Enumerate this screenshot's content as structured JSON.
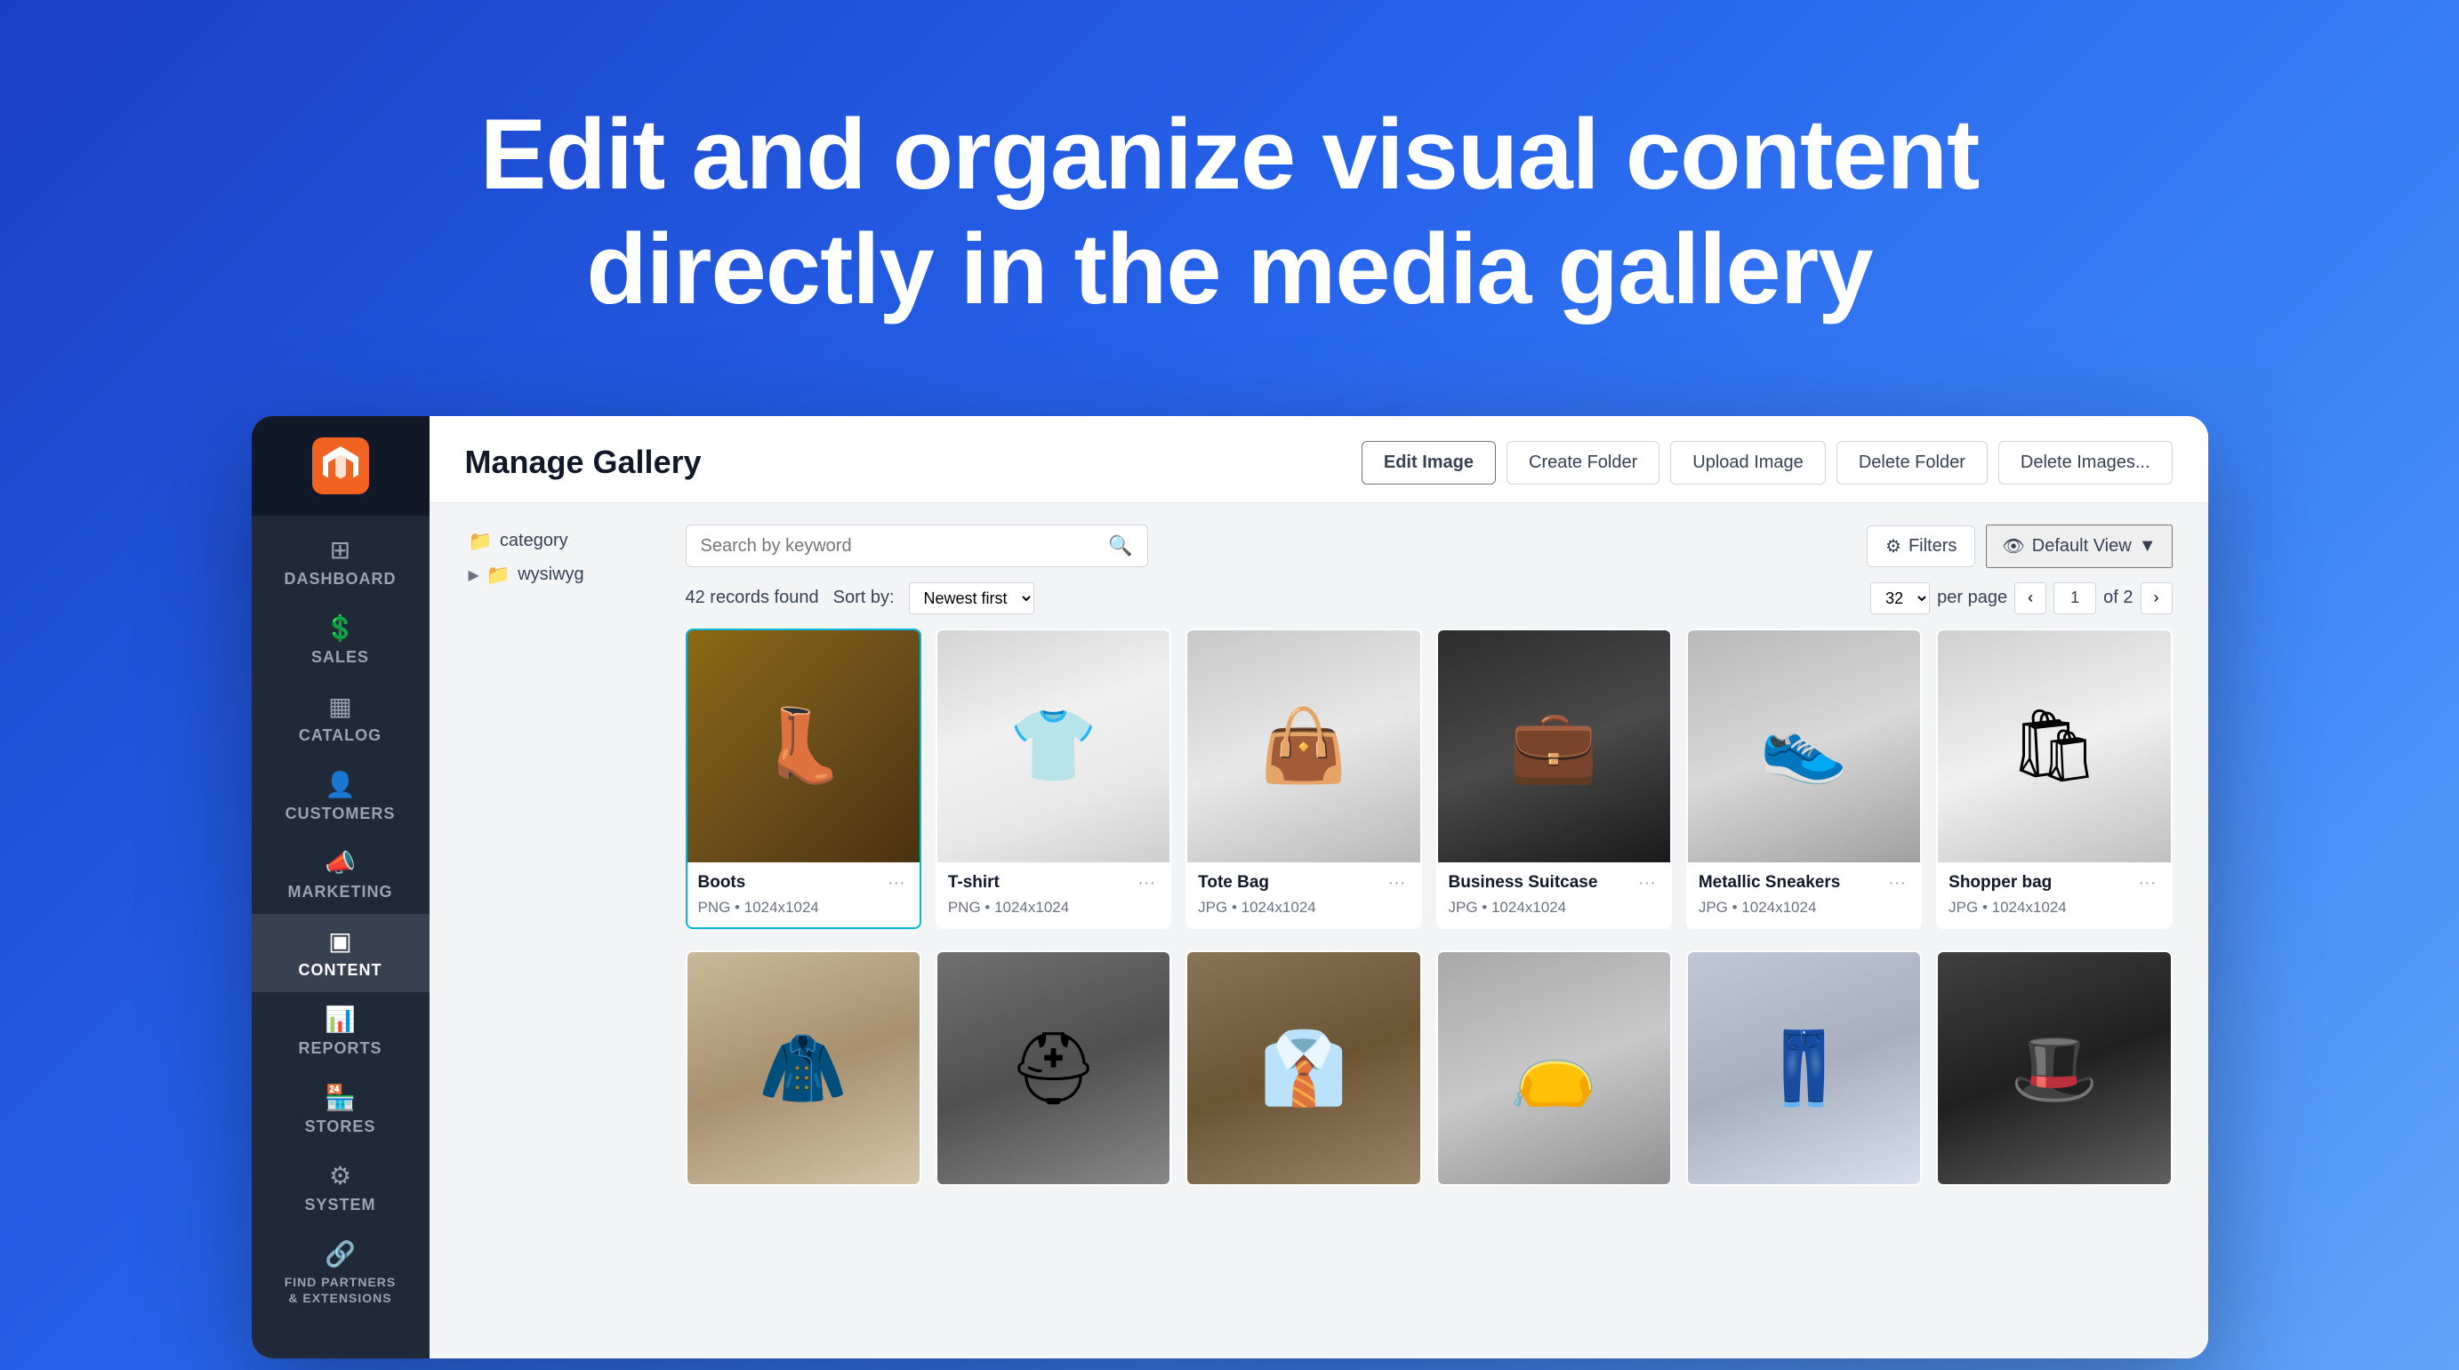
{
  "hero": {
    "title_line1": "Edit and organize visual content",
    "title_line2": "directly in the media gallery"
  },
  "window": {
    "title": "Manage Gallery"
  },
  "sidebar": {
    "logo_alt": "Magento",
    "items": [
      {
        "id": "dashboard",
        "label": "DASHBOARD",
        "icon": "⊞"
      },
      {
        "id": "sales",
        "label": "SALES",
        "icon": "$"
      },
      {
        "id": "catalog",
        "label": "CATALOG",
        "icon": "▦"
      },
      {
        "id": "customers",
        "label": "CUSTOMERS",
        "icon": "👤"
      },
      {
        "id": "marketing",
        "label": "MARKETING",
        "icon": "📣"
      },
      {
        "id": "content",
        "label": "CONTENT",
        "icon": "▣",
        "active": true
      },
      {
        "id": "reports",
        "label": "REPORTS",
        "icon": "📊"
      },
      {
        "id": "stores",
        "label": "STORES",
        "icon": "🏪"
      },
      {
        "id": "system",
        "label": "SYSTEM",
        "icon": "⚙"
      },
      {
        "id": "partners",
        "label": "FIND PARTNERS & EXTENSIONS",
        "icon": "🔗"
      }
    ]
  },
  "toolbar": {
    "edit_image_label": "Edit Image",
    "create_folder_label": "Create Folder",
    "upload_image_label": "Upload Image",
    "delete_folder_label": "Delete Folder",
    "delete_images_label": "Delete Images..."
  },
  "search": {
    "placeholder": "Search by keyword"
  },
  "filters": {
    "label": "Filters"
  },
  "view": {
    "label": "Default View"
  },
  "gallery": {
    "records_found": "42 records found",
    "sort_label": "Sort by:",
    "sort_option": "Newest first",
    "per_page": "per page",
    "per_page_value": "32",
    "page_current": "1",
    "page_total": "of 2"
  },
  "folders": [
    {
      "name": "category",
      "expanded": false
    },
    {
      "name": "wysiwyg",
      "expanded": true
    }
  ],
  "images": [
    {
      "name": "Boots",
      "format": "PNG",
      "dimensions": "1024x1024",
      "selected": true,
      "color_class": "img-boots"
    },
    {
      "name": "T-shirt",
      "format": "PNG",
      "dimensions": "1024x1024",
      "selected": false,
      "color_class": "img-tshirt"
    },
    {
      "name": "Tote Bag",
      "format": "JPG",
      "dimensions": "1024x1024",
      "selected": false,
      "color_class": "img-totebag"
    },
    {
      "name": "Business Suitcase",
      "format": "JPG",
      "dimensions": "1024x1024",
      "selected": false,
      "color_class": "img-briefcase"
    },
    {
      "name": "Metallic Sneakers",
      "format": "JPG",
      "dimensions": "1024x1024",
      "selected": false,
      "color_class": "img-sneakers"
    },
    {
      "name": "Shopper bag",
      "format": "JPG",
      "dimensions": "1024x1024",
      "selected": false,
      "color_class": "img-shopperbag"
    },
    {
      "name": "",
      "format": "",
      "dimensions": "",
      "selected": false,
      "color_class": "img-suit1"
    },
    {
      "name": "",
      "format": "",
      "dimensions": "",
      "selected": false,
      "color_class": "img-helmet"
    },
    {
      "name": "",
      "format": "",
      "dimensions": "",
      "selected": false,
      "color_class": "img-suit2"
    },
    {
      "name": "",
      "format": "",
      "dimensions": "",
      "selected": false,
      "color_class": "img-bag2"
    },
    {
      "name": "",
      "format": "",
      "dimensions": "",
      "selected": false,
      "color_class": "img-pants"
    },
    {
      "name": "",
      "format": "",
      "dimensions": "",
      "selected": false,
      "color_class": "img-hat"
    }
  ]
}
